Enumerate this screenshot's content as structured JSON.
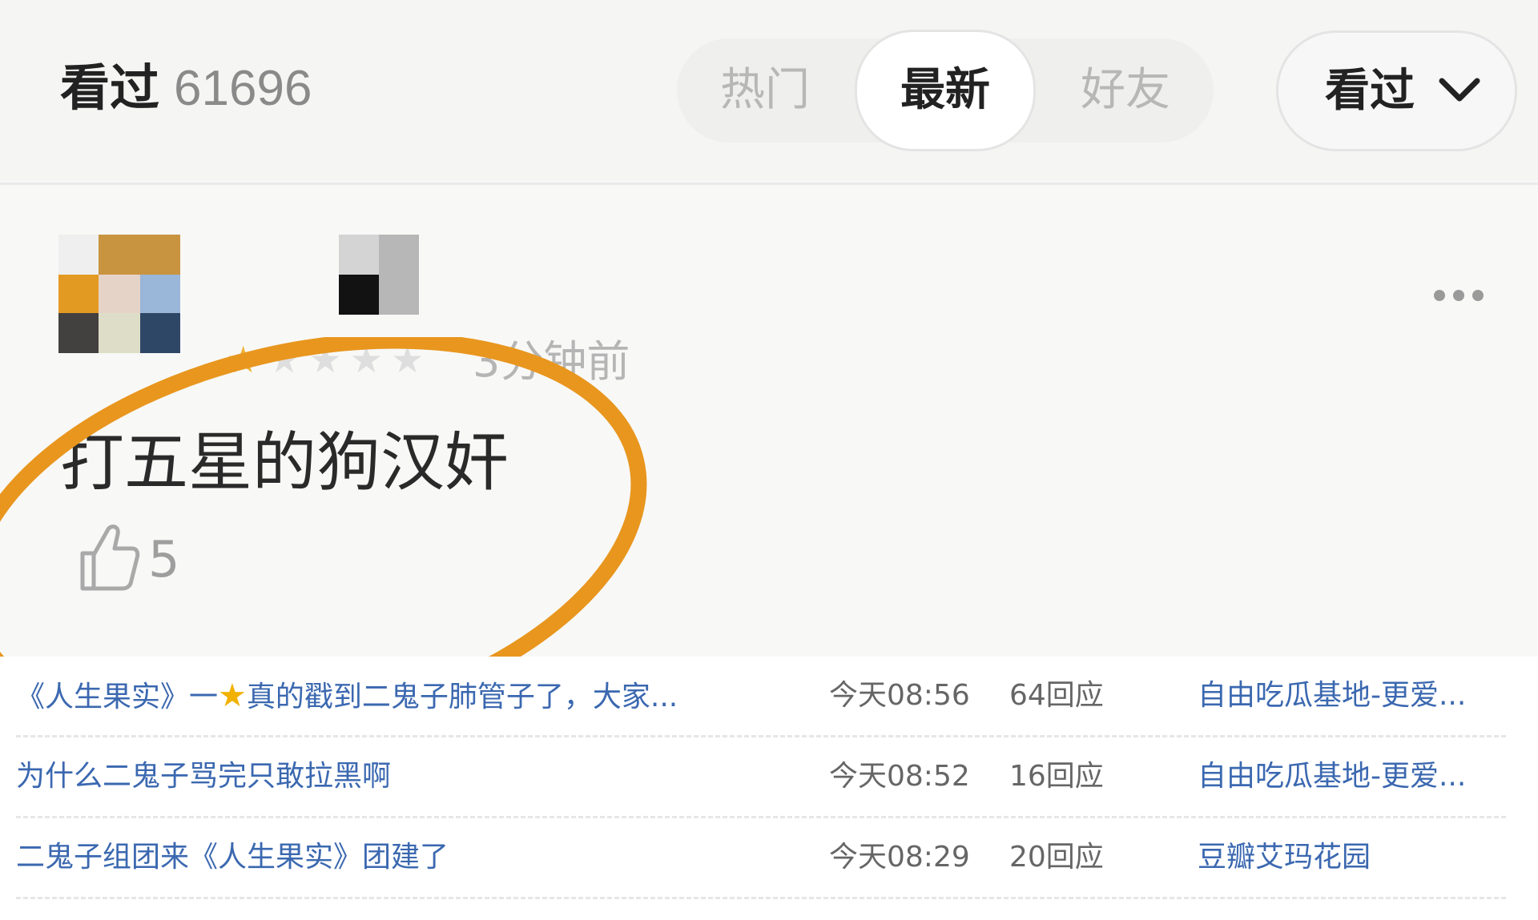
{
  "header": {
    "title": "看过",
    "count": "61696",
    "tabs": [
      {
        "label": "热门",
        "active": false
      },
      {
        "label": "最新",
        "active": true
      },
      {
        "label": "好友",
        "active": false
      }
    ],
    "dropdown": {
      "value": "看过",
      "icon": "chevron-down-icon"
    }
  },
  "review": {
    "rating": 1,
    "rating_max": 5,
    "time": "3分钟前",
    "text": "打五星的狗汉奸",
    "likes": "5",
    "highlight_color": "#e8961e"
  },
  "topics": [
    {
      "title_pre": "《人生果实》一",
      "title_icon": "★",
      "title_post": "真的戳到二鬼子肺管子了，大家...",
      "time": "今天08:56",
      "replies": "64回应",
      "group": "自由吃瓜基地-更爱..."
    },
    {
      "title_pre": "为什么二鬼子骂完只敢拉黑啊",
      "title_icon": "",
      "title_post": "",
      "time": "今天08:52",
      "replies": "16回应",
      "group": "自由吃瓜基地-更爱..."
    },
    {
      "title_pre": "二鬼子组团来《人生果实》团建了",
      "title_icon": "",
      "title_post": "",
      "time": "今天08:29",
      "replies": "20回应",
      "group": "豆瓣艾玛花园"
    }
  ],
  "colors": {
    "link": "#3b68b0",
    "star_on": "#f0b43a",
    "star_off": "#dedede"
  }
}
